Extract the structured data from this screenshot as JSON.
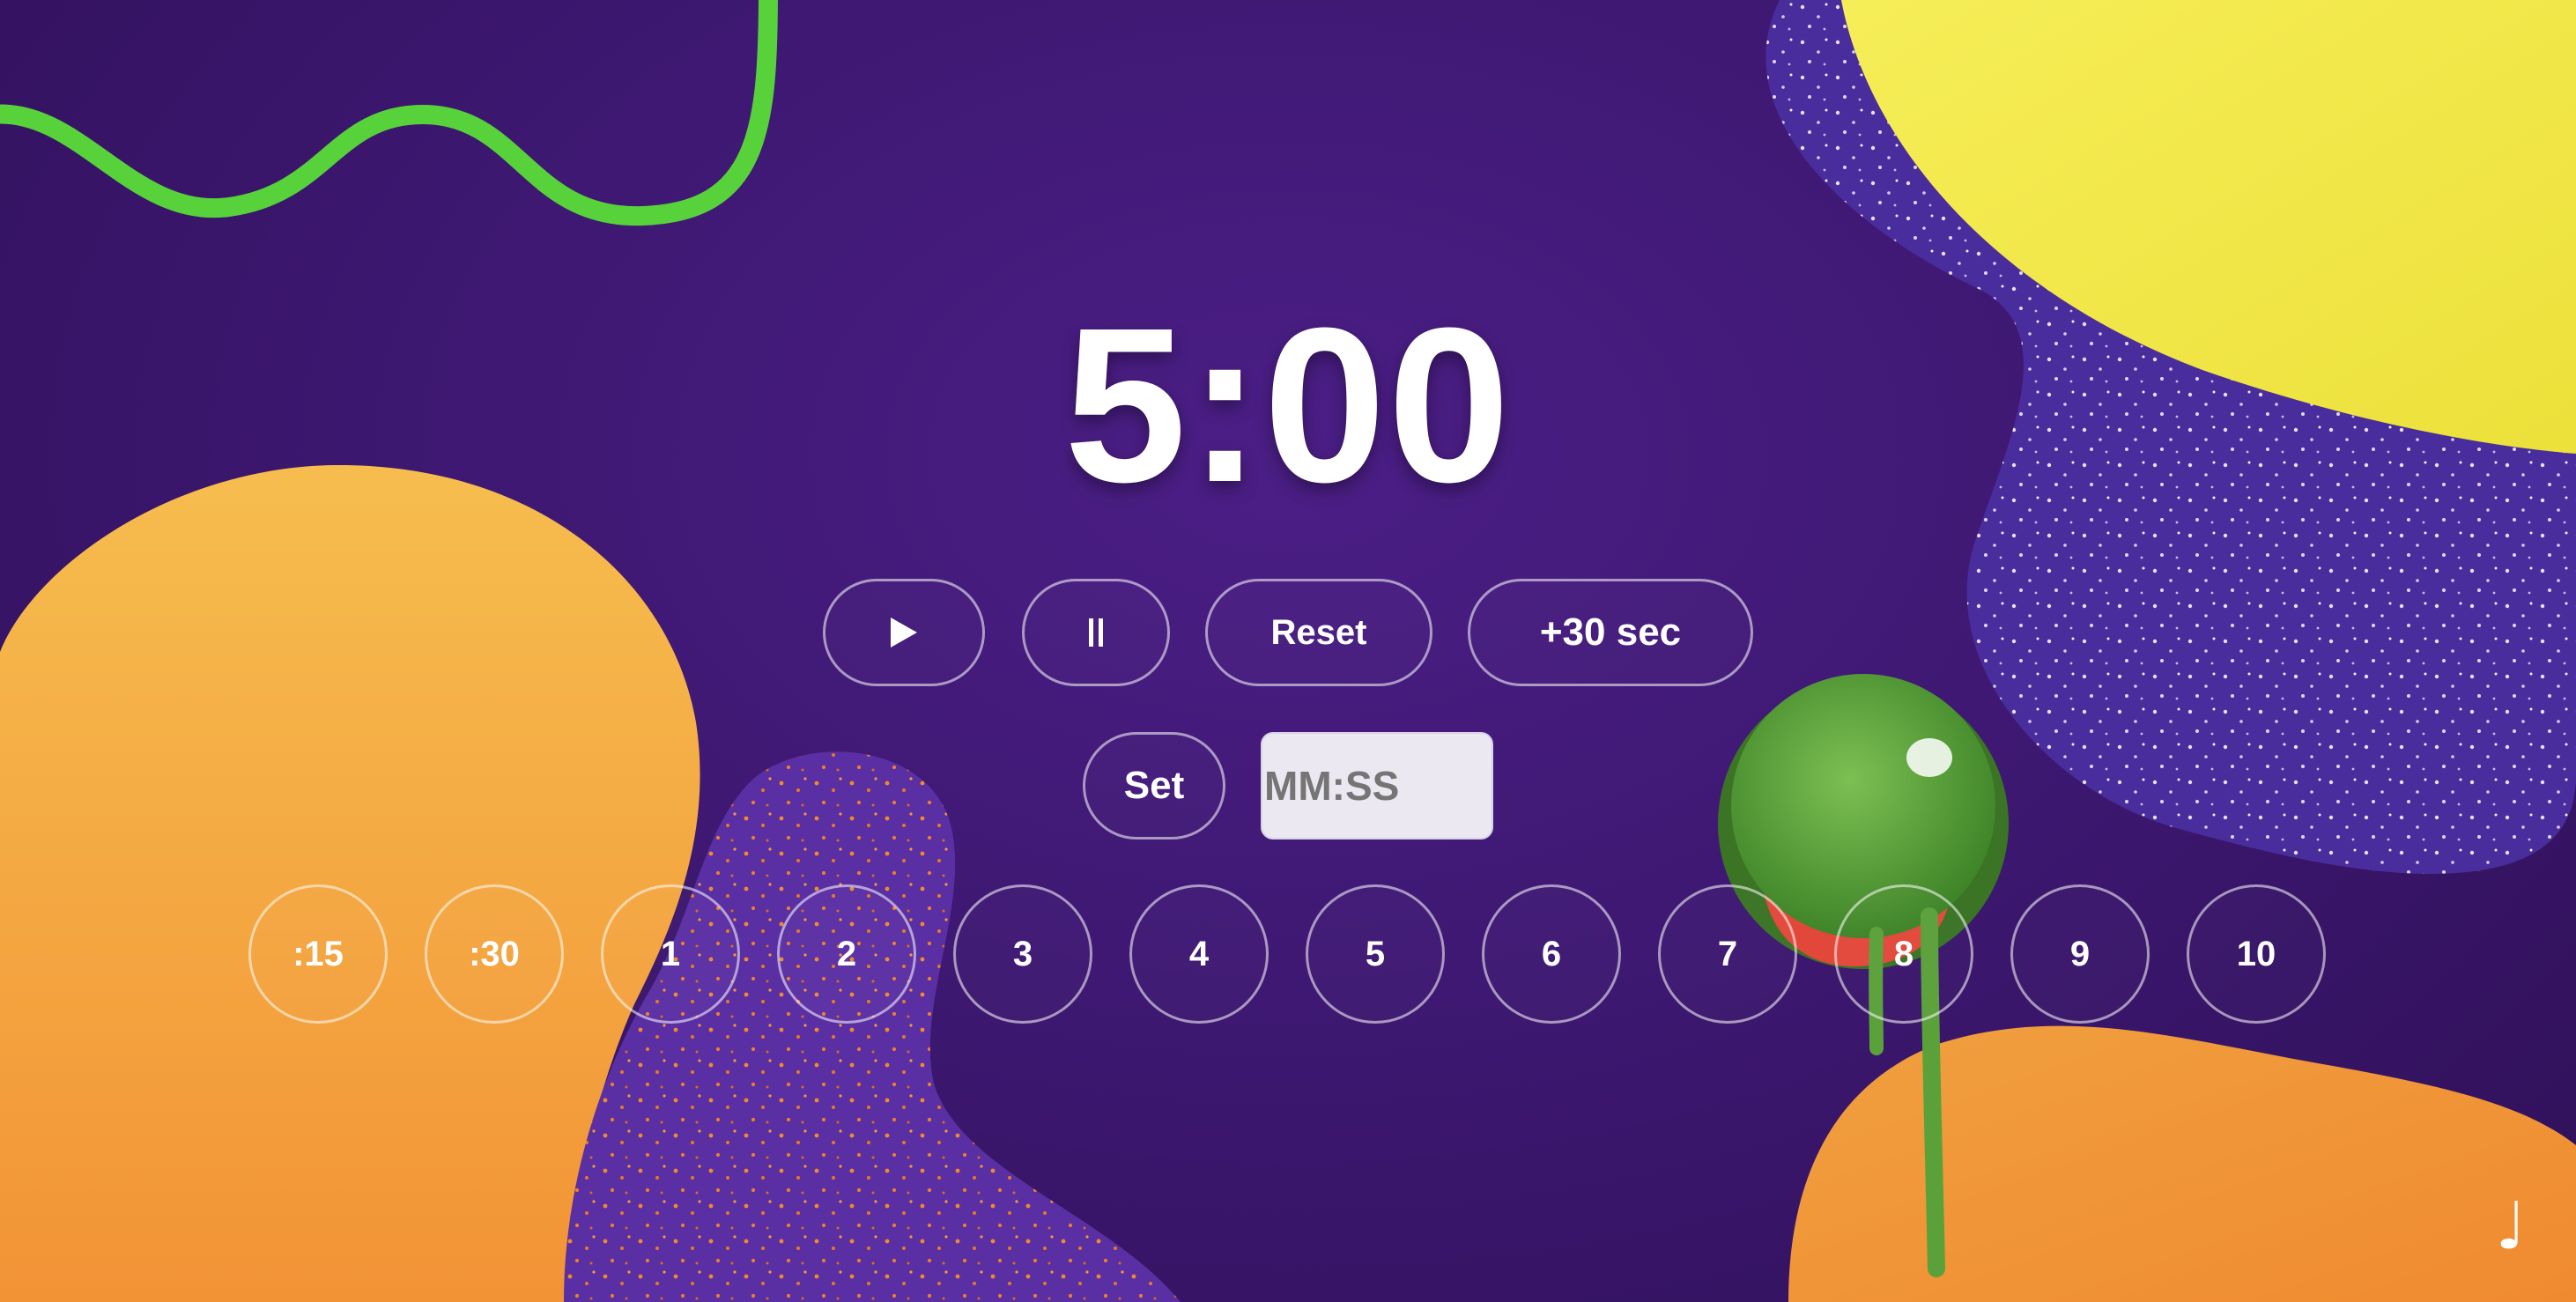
{
  "timer": {
    "display": "5:00"
  },
  "controls": {
    "play_icon": "play-icon",
    "pause_icon": "pause-icon",
    "reset_label": "Reset",
    "add_time_label": "+30 sec",
    "set_label": "Set",
    "time_input_placeholder": "MM:SS"
  },
  "presets": [
    ":15",
    ":30",
    "1",
    "2",
    "3",
    "4",
    "5",
    "6",
    "7",
    "8",
    "9",
    "10"
  ],
  "footer": {
    "music_icon": "music-note-icon"
  },
  "colors": {
    "background": "#3e1872",
    "orange_blob": "#f2a33c",
    "yellow_blob": "#f5ea4a",
    "green_squiggle": "#5ad43a",
    "glitter_blob": "#4a2a9a",
    "slime_ball": "#5aa13a"
  }
}
